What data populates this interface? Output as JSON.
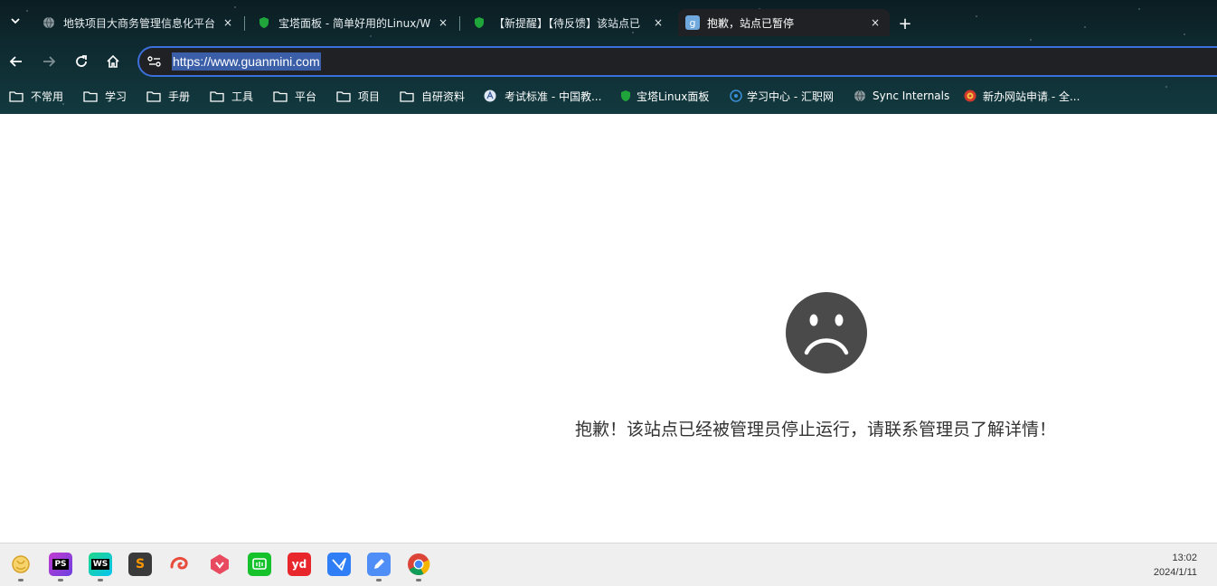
{
  "browser": {
    "tabs": [
      {
        "title": "地铁项目大商务管理信息化平台",
        "favicon": "globe-icon"
      },
      {
        "title": "宝塔面板 - 简单好用的Linux/W",
        "favicon": "bt-shield-icon"
      },
      {
        "title": "【新提醒】【待反馈】该站点已",
        "favicon": "bt-shield-icon"
      },
      {
        "title": "抱歉，站点已暂停",
        "favicon": "site-icon",
        "active": true
      }
    ],
    "close_glyph": "×",
    "new_tab_glyph": "+",
    "url": "https://www.guanmini.com"
  },
  "bookmarks": [
    {
      "label": "不常用",
      "icon": "folder-icon"
    },
    {
      "label": "学习",
      "icon": "folder-icon"
    },
    {
      "label": "手册",
      "icon": "folder-icon"
    },
    {
      "label": "工具",
      "icon": "folder-icon"
    },
    {
      "label": "平台",
      "icon": "folder-icon"
    },
    {
      "label": "项目",
      "icon": "folder-icon"
    },
    {
      "label": "自研资料",
      "icon": "folder-icon"
    },
    {
      "label": "考试标准 - 中国教...",
      "icon": "exam-icon"
    },
    {
      "label": "宝塔Linux面板",
      "icon": "bt-shield-icon"
    },
    {
      "label": "学习中心 - 汇职网",
      "icon": "learning-icon"
    },
    {
      "label": "Sync Internals",
      "icon": "globe-icon"
    },
    {
      "label": "新办网站申请 - 全...",
      "icon": "police-badge-icon"
    }
  ],
  "page": {
    "message": "抱歉！该站点已经被管理员停止运行，请联系管理员了解详情！"
  },
  "taskbar": {
    "apps": [
      {
        "name": "launcher-icon",
        "label": ""
      },
      {
        "name": "phpstorm-icon",
        "label": "PS"
      },
      {
        "name": "webstorm-icon",
        "label": "WS"
      },
      {
        "name": "sublime-icon",
        "label": "S"
      },
      {
        "name": "swirl-app-icon",
        "label": ""
      },
      {
        "name": "red-app-icon",
        "label": ""
      },
      {
        "name": "green-chat-icon",
        "label": ""
      },
      {
        "name": "youdao-icon",
        "label": "yd"
      },
      {
        "name": "bird-app-icon",
        "label": ""
      },
      {
        "name": "pen-app-icon",
        "label": ""
      },
      {
        "name": "chrome-icon",
        "label": ""
      }
    ],
    "time": "13:02",
    "date": "2024/1/11"
  },
  "colors": {
    "accent": "#3b6fd9",
    "sad_face": "#4a4a4a"
  }
}
